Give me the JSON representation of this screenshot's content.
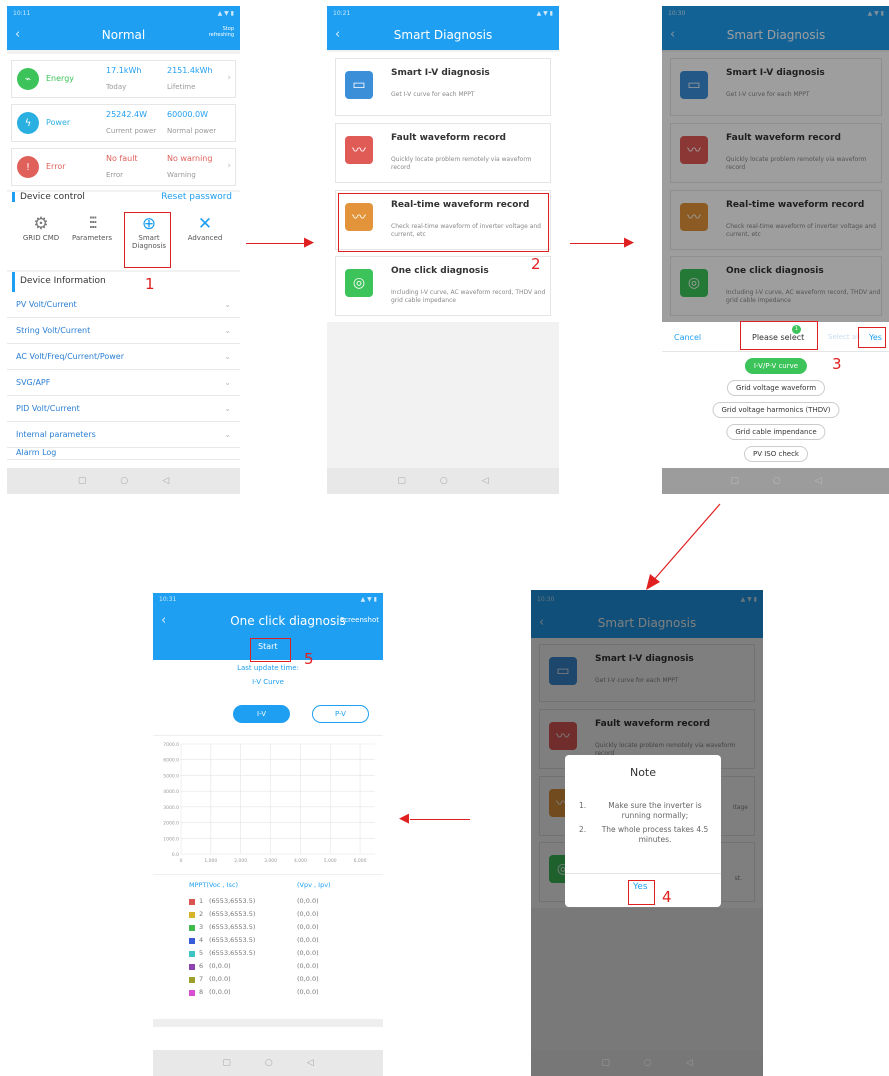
{
  "status": {
    "t1": "10:11",
    "t2": "10:21",
    "t3": "10:30",
    "t4": "10:30",
    "t5": "10:31"
  },
  "screen1": {
    "title": "Normal",
    "stop_refreshing": "Stop refreshing",
    "energy": {
      "label": "Energy",
      "v1": "17.1kWh",
      "l1": "Today",
      "v2": "2151.4kWh",
      "l2": "Lifetime"
    },
    "power": {
      "label": "Power",
      "v1": "25242.4W",
      "l1": "Current power",
      "v2": "60000.0W",
      "l2": "Normal power"
    },
    "error": {
      "label": "Error",
      "v1": "No fault",
      "l1": "Error",
      "v2": "No warning",
      "l2": "Warning"
    },
    "device_control": "Device control",
    "reset_password": "Reset password",
    "controls": {
      "grid": "GRID CMD",
      "params": "Parameters",
      "smart1": "Smart",
      "smart2": "Diagnosis",
      "adv": "Advanced"
    },
    "device_info": "Device Information",
    "rows": [
      "PV Volt/Current",
      "String Volt/Current",
      "AC Volt/Freq/Current/Power",
      "SVG/APF",
      "PID Volt/Current",
      "Internal parameters",
      "Alarm Log"
    ]
  },
  "screen2": {
    "title": "Smart Diagnosis",
    "c1": {
      "title": "Smart I-V diagnosis",
      "desc": "Get I-V curve for each MPPT"
    },
    "c2": {
      "title": "Fault waveform record",
      "desc": "Quickly locate problem remotely via waveform record"
    },
    "c3": {
      "title": "Real-time waveform record",
      "desc": "Check real-time waveform of inverter voltage and current, etc"
    },
    "c4": {
      "title": "One click diagnosis",
      "desc": "Including I-V curve, AC waveform record, THDV and grid cable impedance"
    }
  },
  "screen3": {
    "cancel": "Cancel",
    "please_select": "Please select",
    "select_all": "Select all",
    "yes": "Yes",
    "badge": "1",
    "options": [
      "I-V/P-V curve",
      "Grid voltage waveform",
      "Grid voltage harmonics (THDV)",
      "Grid cable impendance",
      "PV ISO check"
    ]
  },
  "screen4": {
    "note_title": "Note",
    "n1": "1.",
    "line1": "Make sure the inverter is running normally;",
    "n2": "2.",
    "line2": "The whole process takes 4.5 minutes.",
    "yes": "Yes",
    "peek_c2": "itage",
    "peek_c4": "st."
  },
  "screen5": {
    "title": "One click diagnosis",
    "screenshot": "Screenshot",
    "start": "Start",
    "last_update": "Last update time:",
    "curve_label": "I-V Curve",
    "tab_iv": "I-V",
    "tab_pv": "P-V",
    "col1": "MPPT(Voc , Isc)",
    "col2": "(Vpv , Ipv)",
    "legend": [
      {
        "n": "1",
        "v": "(6553,6553.5)",
        "p": "(0,0.0)",
        "color": "#d9534f"
      },
      {
        "n": "2",
        "v": "(6553,6553.5)",
        "p": "(0,0.0)",
        "color": "#d4b52a"
      },
      {
        "n": "3",
        "v": "(6553,6553.5)",
        "p": "(0,0.0)",
        "color": "#3fb950"
      },
      {
        "n": "4",
        "v": "(6553,6553.5)",
        "p": "(0,0.0)",
        "color": "#3a5bd9"
      },
      {
        "n": "5",
        "v": "(6553,6553.5)",
        "p": "(0,0.0)",
        "color": "#3cc4c4"
      },
      {
        "n": "6",
        "v": "(0,0.0)",
        "p": "(0,0.0)",
        "color": "#8e44ad"
      },
      {
        "n": "7",
        "v": "(0,0.0)",
        "p": "(0,0.0)",
        "color": "#9aa02a"
      },
      {
        "n": "8",
        "v": "(0,0.0)",
        "p": "(0,0.0)",
        "color": "#d94fd0"
      }
    ]
  },
  "chart_data": {
    "type": "line",
    "x_ticks": [
      "0",
      "1,000",
      "2,000",
      "3,000",
      "4,000",
      "5,000",
      "6,000"
    ],
    "y_ticks": [
      "0.0",
      "1000.0",
      "2000.0",
      "3000.0",
      "4000.0",
      "5000.0",
      "6000.0",
      "7000.0"
    ],
    "xlim": [
      0,
      6500
    ],
    "ylim": [
      0,
      7000
    ],
    "series": []
  },
  "steps": [
    "1",
    "2",
    "3",
    "4",
    "5"
  ],
  "colors": {
    "accent": "#1e9ff2",
    "marker": "#e02020"
  }
}
